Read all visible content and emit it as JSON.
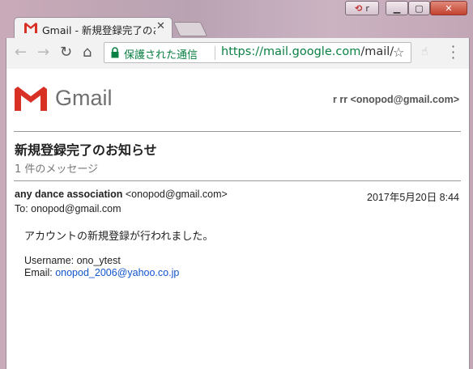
{
  "browser": {
    "tab_title": "Gmail - 新規登録完了のお",
    "profile_label": "r",
    "security_label": "保護された通信",
    "url_origin": "https://mail.google.com",
    "url_path": "/mail/"
  },
  "gmail": {
    "logo_text": "Gmail",
    "account": "r rr <onopod@gmail.com>",
    "subject": "新規登録完了のお知らせ",
    "message_count": "1 件のメッセージ"
  },
  "message": {
    "sender_name": "any dance association",
    "sender_email": "<onopod@gmail.com>",
    "date": "2017年5月20日 8:44",
    "to": "To: onopod@gmail.com",
    "body_line1": "アカウントの新規登録が行われました。",
    "username_label": "Username: ",
    "username_value": "ono_ytest",
    "email_label": "Email: ",
    "email_value": "onopod_2006@yahoo.co.jp"
  },
  "colors": {
    "gmail_red": "#d93025",
    "secure_green": "#0b8043",
    "link_blue": "#1155cc"
  }
}
